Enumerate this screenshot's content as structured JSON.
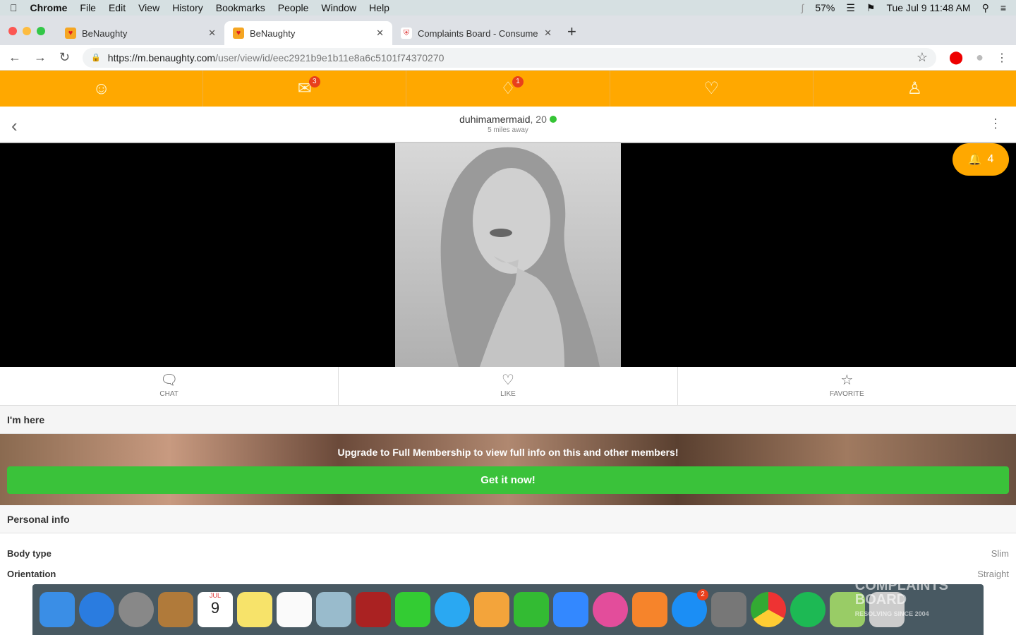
{
  "menubar": {
    "app": "Chrome",
    "items": [
      "File",
      "Edit",
      "View",
      "History",
      "Bookmarks",
      "People",
      "Window",
      "Help"
    ],
    "battery": "57%",
    "datetime": "Tue Jul 9  11:48 AM"
  },
  "tabs": [
    {
      "title": "BeNaughty"
    },
    {
      "title": "BeNaughty"
    },
    {
      "title": "Complaints Board - Consumer"
    }
  ],
  "address": {
    "host": "https://m.benaughty.com",
    "path": "/user/view/id/eec2921b9e1b11e8a6c5101f74370270"
  },
  "topnav": {
    "chat_badge": "3",
    "notif_badge": "1"
  },
  "profile": {
    "username": "duhimamermaid",
    "age": ", 20",
    "distance": "5 miles away",
    "bell_count": "4"
  },
  "actions": {
    "chat": "CHAT",
    "like": "LIKE",
    "favorite": "FAVORITE"
  },
  "sections": {
    "here": "I'm here",
    "personal": "Personal info"
  },
  "upgrade": {
    "text": "Upgrade to Full Membership to view full info on this and other members!",
    "button": "Get it now!"
  },
  "personal_info": [
    {
      "key": "Body type",
      "value": "Slim"
    },
    {
      "key": "Orientation",
      "value": "Straight"
    }
  ],
  "dock": {
    "calendar_month": "JUL",
    "calendar_day": "9",
    "appstore_badge": "2"
  },
  "watermark": {
    "line1": "COMPLAINTS",
    "line2": "BOARD",
    "tag": "RESOLVING SINCE 2004"
  }
}
